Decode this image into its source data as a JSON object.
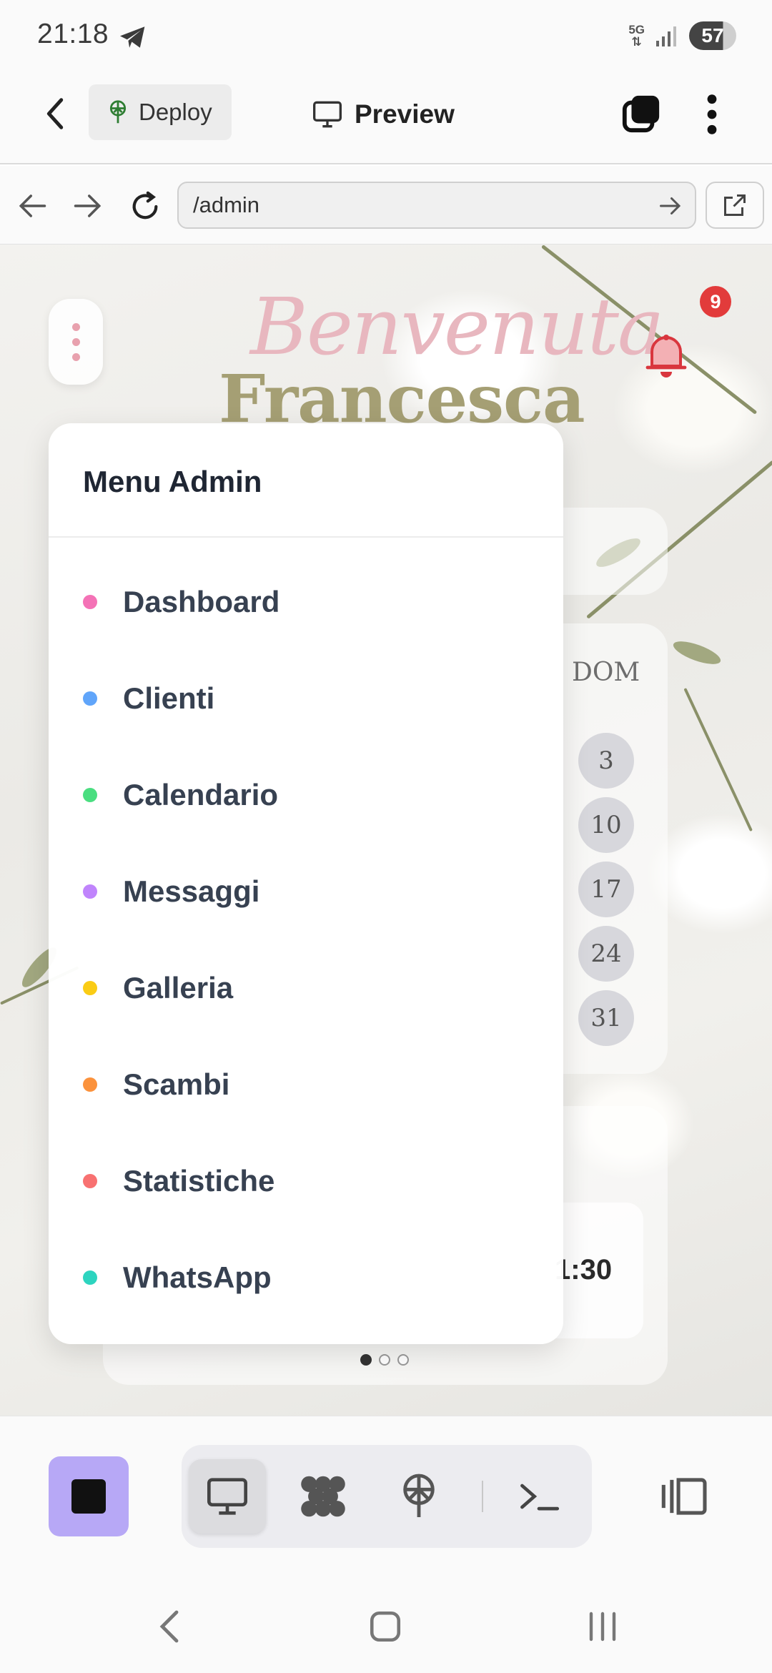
{
  "status_bar": {
    "time": "21:18",
    "network": "5G",
    "battery": "57"
  },
  "app_bar": {
    "deploy_label": "Deploy",
    "preview_label": "Preview"
  },
  "browser": {
    "url": "/admin"
  },
  "page": {
    "greeting_script": "Benvenuta",
    "greeting_name": "Francesca",
    "notification_count": "9",
    "calendar_header": "DOM",
    "calendar_days": [
      "3",
      "10",
      "17",
      "24",
      "31"
    ],
    "appointment_time": "1:30",
    "pager": {
      "total": 3,
      "active_index": 0
    }
  },
  "admin_menu": {
    "title": "Menu Admin",
    "items": [
      {
        "label": "Dashboard",
        "color": "#f472b6"
      },
      {
        "label": "Clienti",
        "color": "#60a5fa"
      },
      {
        "label": "Calendario",
        "color": "#4ade80"
      },
      {
        "label": "Messaggi",
        "color": "#c084fc"
      },
      {
        "label": "Galleria",
        "color": "#facc15"
      },
      {
        "label": "Scambi",
        "color": "#fb923c"
      },
      {
        "label": "Statistiche",
        "color": "#f87171"
      },
      {
        "label": "WhatsApp",
        "color": "#2dd4bf"
      }
    ]
  },
  "toolbar": {
    "stop_color": "#b7a8f6",
    "items": [
      "desktop-preview-icon",
      "workflow-icon",
      "deploy-icon",
      "terminal-icon"
    ]
  }
}
